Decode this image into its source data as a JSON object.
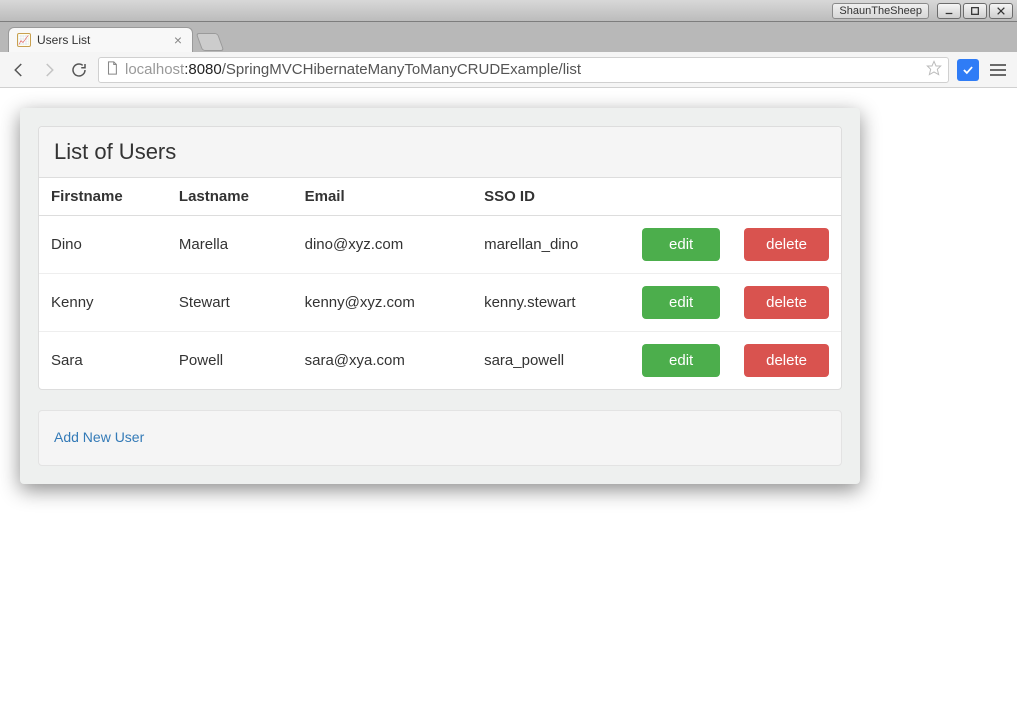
{
  "os": {
    "user_label": "ShaunTheSheep"
  },
  "tab": {
    "title": "Users List"
  },
  "address": {
    "host_light": "localhost",
    "host_dark": ":8080",
    "path": "/SpringMVCHibernateManyToManyCRUDExample/list"
  },
  "page": {
    "heading": "List of Users",
    "columns": {
      "firstname": "Firstname",
      "lastname": "Lastname",
      "email": "Email",
      "ssoid": "SSO ID"
    },
    "actions": {
      "edit": "edit",
      "delete": "delete"
    },
    "add_link": "Add New User",
    "rows": [
      {
        "firstname": "Dino",
        "lastname": "Marella",
        "email": "dino@xyz.com",
        "ssoid": "marellan_dino"
      },
      {
        "firstname": "Kenny",
        "lastname": "Stewart",
        "email": "kenny@xyz.com",
        "ssoid": "kenny.stewart"
      },
      {
        "firstname": "Sara",
        "lastname": "Powell",
        "email": "sara@xya.com",
        "ssoid": "sara_powell"
      }
    ]
  },
  "colors": {
    "success": "#4cae4c",
    "danger": "#d9534f",
    "link": "#337ab7"
  }
}
